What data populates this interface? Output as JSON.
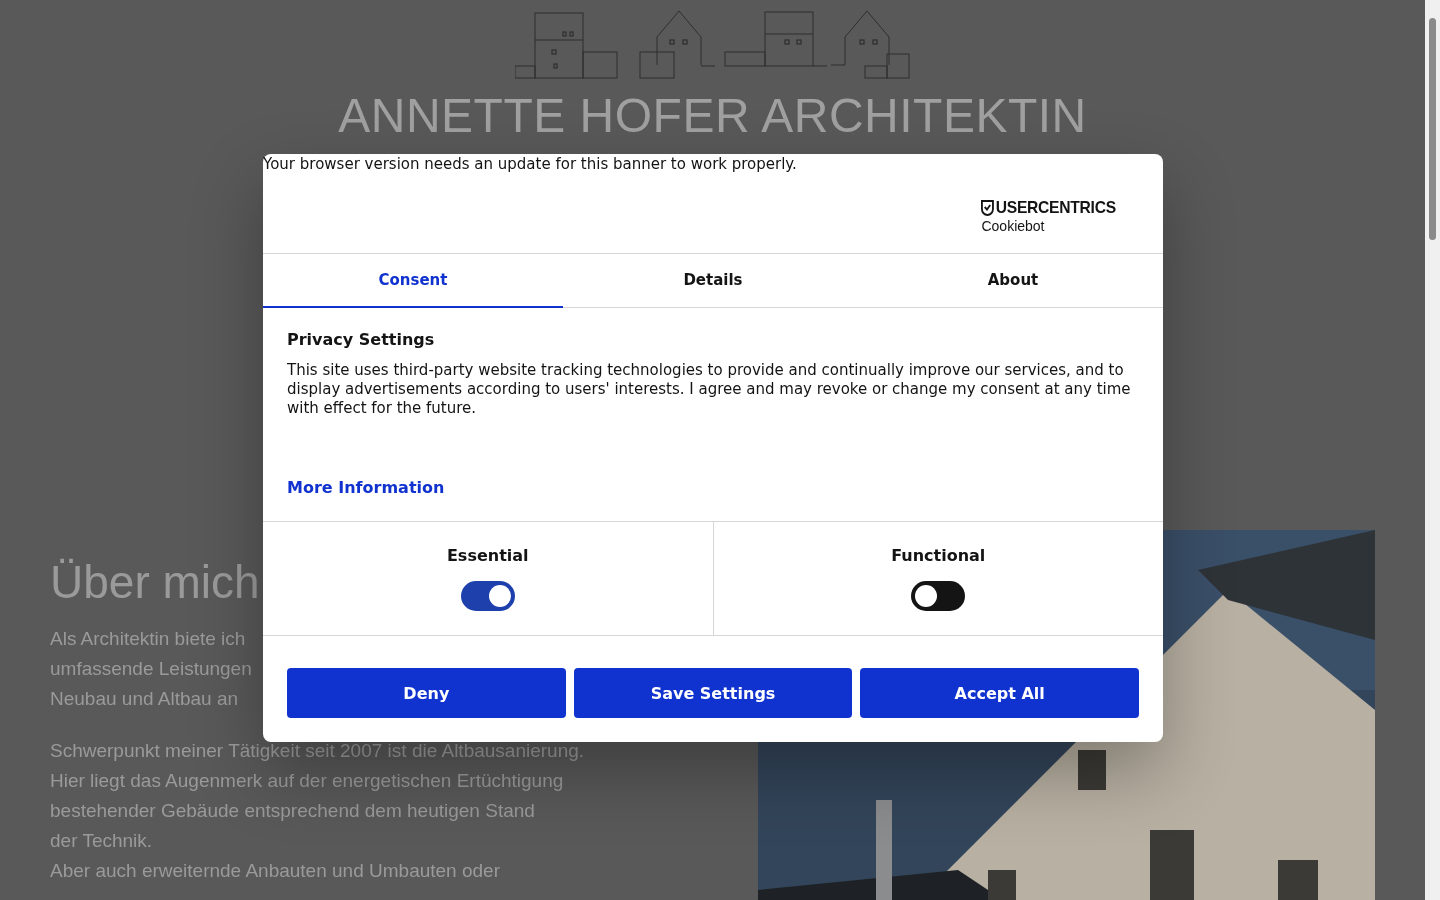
{
  "header": {
    "title": "ANNETTE HOFER ARCHITEKTIN"
  },
  "about": {
    "heading": "Über mich",
    "paragraphs": [
      [
        "Als Architektin biete ich",
        "umfassende Leistungen",
        "Neubau und Altbau an"
      ],
      [
        "Schwerpunkt meiner Tätigkeit seit 2007 ist die Altbausanierung.",
        "Hier liegt das Augenmerk auf der energetischen Ertüchtigung",
        "bestehender Gebäude entsprechend dem heutigen Stand",
        "der Technik.",
        "Aber auch erweiternde Anbauten und Umbauten oder"
      ]
    ]
  },
  "cookie_banner": {
    "notice": "Your browser version needs an update for this banner to work properly.",
    "logo": {
      "brand": "USERCENTRICS",
      "product": "Cookiebot"
    },
    "tabs": [
      {
        "label": "Consent",
        "selected": true
      },
      {
        "label": "Details",
        "selected": false
      },
      {
        "label": "About",
        "selected": false
      }
    ],
    "heading": "Privacy Settings",
    "text": "This site uses third-party website tracking technologies to provide and continually improve our services, and to display advertisements according to users' interests. I agree and may revoke or change my consent at any time with effect for the future.",
    "link": "More Information",
    "categories": [
      {
        "label": "Essential",
        "on": true
      },
      {
        "label": "Functional",
        "on": false
      }
    ],
    "buttons": [
      "Deny",
      "Save Settings",
      "Accept All"
    ]
  }
}
